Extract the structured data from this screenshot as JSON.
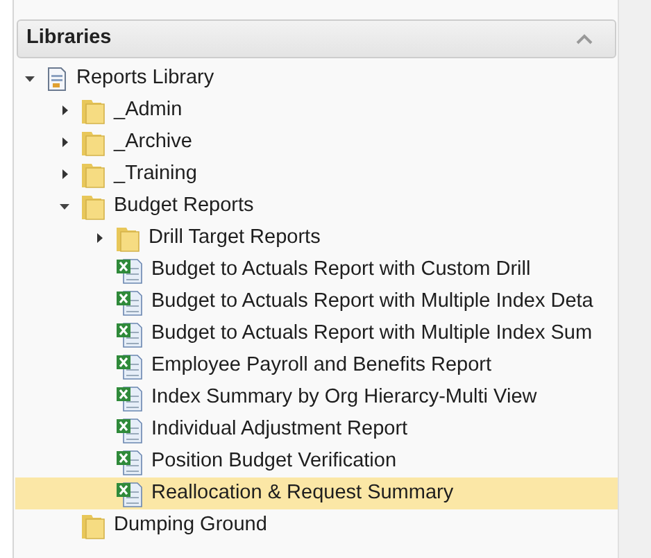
{
  "panel": {
    "title": "Libraries"
  },
  "tree": [
    {
      "kind": "library",
      "label": "Reports Library",
      "expanded": true,
      "selected": false,
      "children": [
        {
          "kind": "folder",
          "label": "_Admin",
          "expanded": false,
          "selected": false
        },
        {
          "kind": "folder",
          "label": "_Archive",
          "expanded": false,
          "selected": false
        },
        {
          "kind": "folder",
          "label": "_Training",
          "expanded": false,
          "selected": false
        },
        {
          "kind": "folder",
          "label": "Budget Reports",
          "expanded": true,
          "selected": false,
          "children": [
            {
              "kind": "folder",
              "label": "Drill Target Reports",
              "expanded": false,
              "selected": false
            },
            {
              "kind": "report",
              "label": "Budget to Actuals Report with Custom Drill",
              "selected": false
            },
            {
              "kind": "report",
              "label": "Budget to Actuals Report with Multiple Index Deta",
              "selected": false
            },
            {
              "kind": "report",
              "label": "Budget to Actuals Report with Multiple Index Sum",
              "selected": false
            },
            {
              "kind": "report",
              "label": "Employee Payroll and Benefits Report",
              "selected": false
            },
            {
              "kind": "report",
              "label": "Index Summary by Org Hierarcy-Multi View",
              "selected": false
            },
            {
              "kind": "report",
              "label": "Individual Adjustment Report",
              "selected": false
            },
            {
              "kind": "report",
              "label": "Position Budget Verification",
              "selected": false
            },
            {
              "kind": "report",
              "label": "Reallocation & Request Summary",
              "selected": true
            }
          ]
        },
        {
          "kind": "folder",
          "label": "Dumping Ground",
          "selected": false
        }
      ]
    }
  ]
}
